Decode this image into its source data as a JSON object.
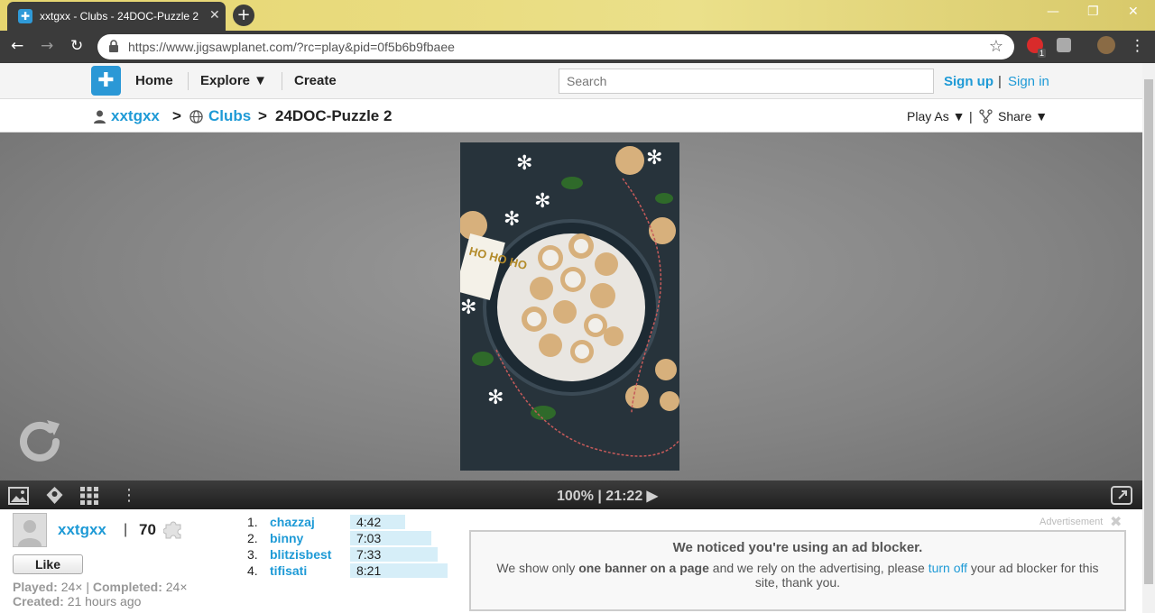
{
  "browser": {
    "tab_title": "xxtgxx - Clubs - 24DOC-Puzzle 2",
    "url": "https://www.jigsawplanet.com/?rc=play&pid=0f5b6b9fbaee",
    "ext_badge": "1"
  },
  "header": {
    "menu": {
      "home": "Home",
      "explore": "Explore ▼",
      "create": "Create"
    },
    "search_placeholder": "Search",
    "sign_up": "Sign up",
    "auth_sep": "|",
    "sign_in": "Sign in"
  },
  "breadcrumb": {
    "user": "xxtgxx",
    "sep1": ">",
    "clubs": "Clubs",
    "sep2": ">",
    "puzzle": "24DOC-Puzzle 2",
    "play_as": "Play As ▼",
    "sep3": "|",
    "share": "Share ▼"
  },
  "puzzle_bar": {
    "status": "100% | 21:22 ▶"
  },
  "photo": {
    "sign_text": "HO HO HO"
  },
  "owner": {
    "name": "xxtgxx",
    "sep": "|",
    "pieces": "70",
    "like_label": "Like",
    "played_label": "Played:",
    "played_value": "24×",
    "stat_sep": "|",
    "completed_label": "Completed:",
    "completed_value": "24×",
    "created_label": "Created:",
    "created_value": "21 hours ago"
  },
  "leaderboard": [
    {
      "rank": "1.",
      "name": "chazzaj",
      "time": "4:42",
      "time_fraction": 0.55
    },
    {
      "rank": "2.",
      "name": "binny",
      "time": "7:03",
      "time_fraction": 0.82
    },
    {
      "rank": "3.",
      "name": "blitzisbest",
      "time": "7:33",
      "time_fraction": 0.88
    },
    {
      "rank": "4.",
      "name": "tifisati",
      "time": "8:21",
      "time_fraction": 0.98
    }
  ],
  "ad": {
    "label": "Advertisement",
    "title": "We noticed you're using an ad blocker.",
    "text_1": "We show only ",
    "text_bold": "one banner on a page",
    "text_2": " and we rely on the advertising, please ",
    "text_link": "turn off",
    "text_3": " your ad blocker for this site, thank you."
  }
}
